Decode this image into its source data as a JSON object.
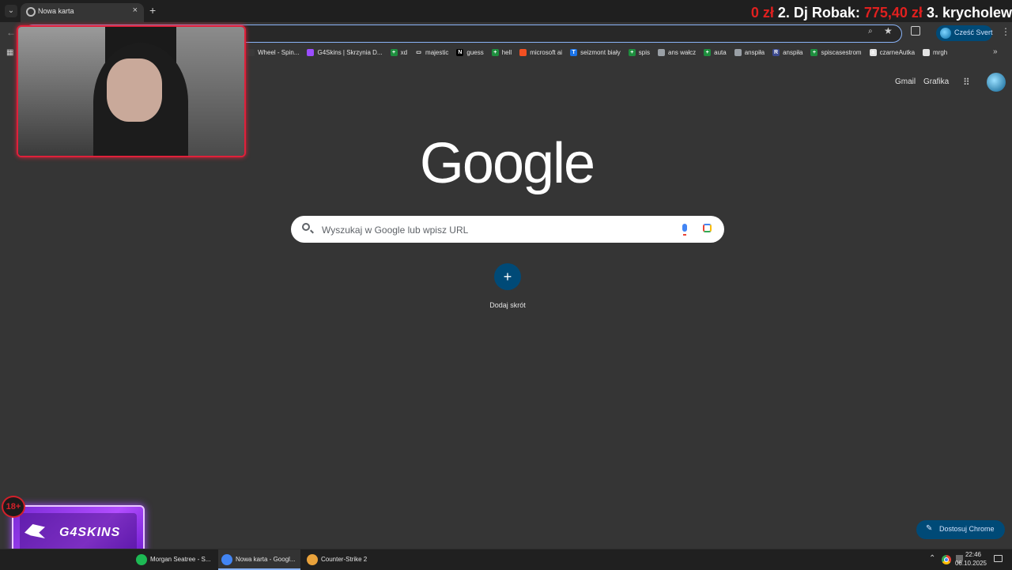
{
  "browser": {
    "tab_title": "Nowa karta",
    "tab_close": "×",
    "new_tab": "+",
    "profile_chip_label": "Cześć Svert",
    "bookmarks": [
      {
        "label": "Wheel - Spin...",
        "icon_color": "#3a3a3a",
        "icon_char": ""
      },
      {
        "label": "G4Skins | Skrzynia D...",
        "icon_color": "#9b4dff",
        "icon_char": ""
      },
      {
        "label": "xd",
        "icon_color": "#1e8e3e",
        "icon_char": "+"
      },
      {
        "label": "majestic",
        "icon_color": "#353535",
        "icon_char": "▭"
      },
      {
        "label": "guess",
        "icon_color": "#000000",
        "icon_char": "N"
      },
      {
        "label": "hell",
        "icon_color": "#1e8e3e",
        "icon_char": "+"
      },
      {
        "label": "microsoft ai",
        "icon_color": "#f25022",
        "icon_char": ""
      },
      {
        "label": "seizmont biały",
        "icon_color": "#1a73e8",
        "icon_char": "T"
      },
      {
        "label": "spis",
        "icon_color": "#1e8e3e",
        "icon_char": "+"
      },
      {
        "label": "ans wałcz",
        "icon_color": "#9aa0a6",
        "icon_char": ""
      },
      {
        "label": "auta",
        "icon_color": "#1e8e3e",
        "icon_char": "+"
      },
      {
        "label": "anspiła",
        "icon_color": "#9aa0a6",
        "icon_char": ""
      },
      {
        "label": "anspiła",
        "icon_color": "#3c4a8f",
        "icon_char": "R"
      },
      {
        "label": "spiscasestrom",
        "icon_color": "#1e8e3e",
        "icon_char": "+"
      },
      {
        "label": "czarneAutka",
        "icon_color": "#e3e3e3",
        "icon_char": "a"
      },
      {
        "label": "mrgh",
        "icon_color": "#e3e3e3",
        "icon_char": ""
      }
    ]
  },
  "stream_overlay": {
    "donation_parts": [
      {
        "text": "0 zł",
        "amount": true
      },
      {
        "text": "  2. Dj Robak: ",
        "amount": false
      },
      {
        "text": "775,40 zł",
        "amount": true
      },
      {
        "text": "   3. krycholew",
        "amount": false
      }
    ],
    "sponsor_text": "G4SKINS",
    "age_badge": "18+"
  },
  "google": {
    "links": {
      "gmail": "Gmail",
      "images": "Grafika"
    },
    "logo": "Google",
    "search_placeholder": "Wyszukaj w Google lub wpisz URL",
    "add_shortcut_label": "Dodaj skrót",
    "add_shortcut_symbol": "+",
    "customize_label": "Dostosuj Chrome",
    "customize_icon": "✎"
  },
  "taskbar": {
    "items": [
      {
        "label": "Morgan Seatree - S...",
        "icon": "spotify-icon",
        "color": "#1db954",
        "active": false
      },
      {
        "label": "Nowa karta - Googl...",
        "icon": "chrome-icon",
        "color": "#4285f4",
        "active": true
      },
      {
        "label": "Counter-Strike 2",
        "icon": "cs2-icon",
        "color": "#e9a23b",
        "active": false
      }
    ],
    "time": "22:46",
    "date": "06.10.2025"
  }
}
